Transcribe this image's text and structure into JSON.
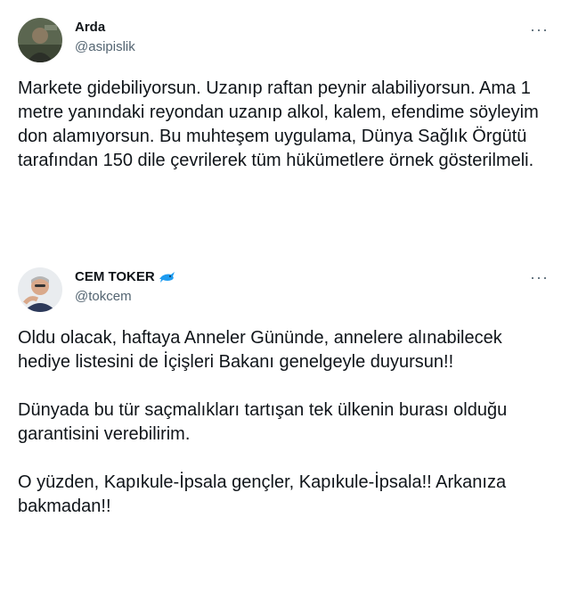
{
  "tweets": [
    {
      "display_name": "Arda",
      "handle": "@asipislik",
      "more_label": "···",
      "avatar_icon": "user-avatar-photo",
      "verified_icon": null,
      "paragraphs": [
        "Markete gidebiliyorsun. Uzanıp raftan peynir alabiliyorsun. Ama 1 metre yanındaki reyondan uzanıp alkol, kalem, efendime söyleyim don alamıyorsun. Bu muhteşem uygulama, Dünya Sağlık Örgütü tarafından 150 dile çevrilerek tüm hükümetlere örnek gösterilmeli."
      ]
    },
    {
      "display_name": "CEM TOKER",
      "handle": "@tokcem",
      "more_label": "···",
      "avatar_icon": "user-avatar-photo",
      "badge_icon": "dolphin-emoji-icon",
      "paragraphs": [
        "Oldu olacak, haftaya Anneler Gününde, annelere alınabilecek hediye listesini de İçişleri Bakanı genelgeyle duyursun!!",
        "Dünyada bu tür saçmalıkları tartışan tek ülkenin burası olduğu garantisini verebilirim.",
        "O yüzden, Kapıkule-İpsala gençler, Kapıkule-İpsala!! Arkanıza bakmadan!!"
      ]
    }
  ],
  "colors": {
    "text": "#0f1419",
    "secondary": "#536471",
    "badge": "#1d9bf0",
    "background": "#ffffff"
  }
}
